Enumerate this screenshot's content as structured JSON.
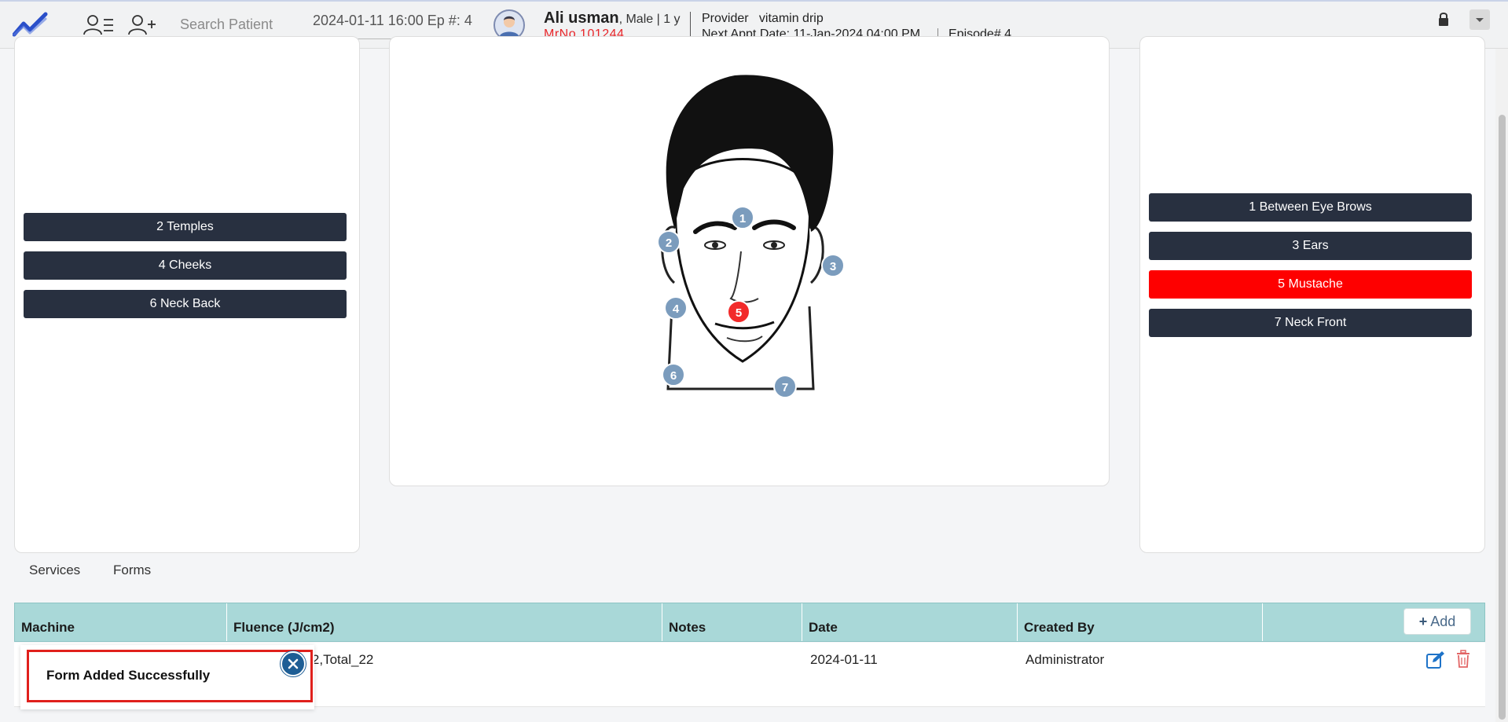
{
  "header": {
    "search_placeholder": "Search Patient",
    "episode_select": "2024-01-11 16:00 Ep #: 4",
    "patient_name": "Ali usman",
    "patient_meta": ", Male | 1 y",
    "mrno": "MrNo 101244",
    "provider_label": "Provider",
    "provider_value": "vitamin drip",
    "next_appt_label": "Next Appt Date:",
    "next_appt_value": "11-Jan-2024 04:00 PM",
    "episode": "Episode# 4"
  },
  "areas_left": [
    {
      "label": "2 Temples",
      "active": false
    },
    {
      "label": "4 Cheeks",
      "active": false
    },
    {
      "label": "6 Neck Back",
      "active": false
    }
  ],
  "areas_right": [
    {
      "label": "1 Between Eye Brows",
      "active": false
    },
    {
      "label": "3 Ears",
      "active": false
    },
    {
      "label": "5 Mustache",
      "active": true
    },
    {
      "label": "7 Neck Front",
      "active": false
    }
  ],
  "face_markers": [
    "1",
    "2",
    "3",
    "4",
    "5",
    "6",
    "7"
  ],
  "active_marker": "5",
  "tabs": [
    "Services",
    "Forms"
  ],
  "table": {
    "columns": [
      "Machine",
      "Fluence (J/cm2)",
      "Notes",
      "Date",
      "Created By"
    ],
    "add_label": "Add",
    "rows": [
      {
        "fluence": "_12,Total_22",
        "date": "2024-01-11",
        "created_by": "Administrator"
      }
    ]
  },
  "toast": {
    "message": "Form Added Successfully"
  },
  "colors": {
    "area_button": "#283040",
    "area_active": "#fe0000",
    "marker": "#7b9cbd",
    "marker_active": "#f22a2a",
    "table_head": "#a9d8d8"
  }
}
